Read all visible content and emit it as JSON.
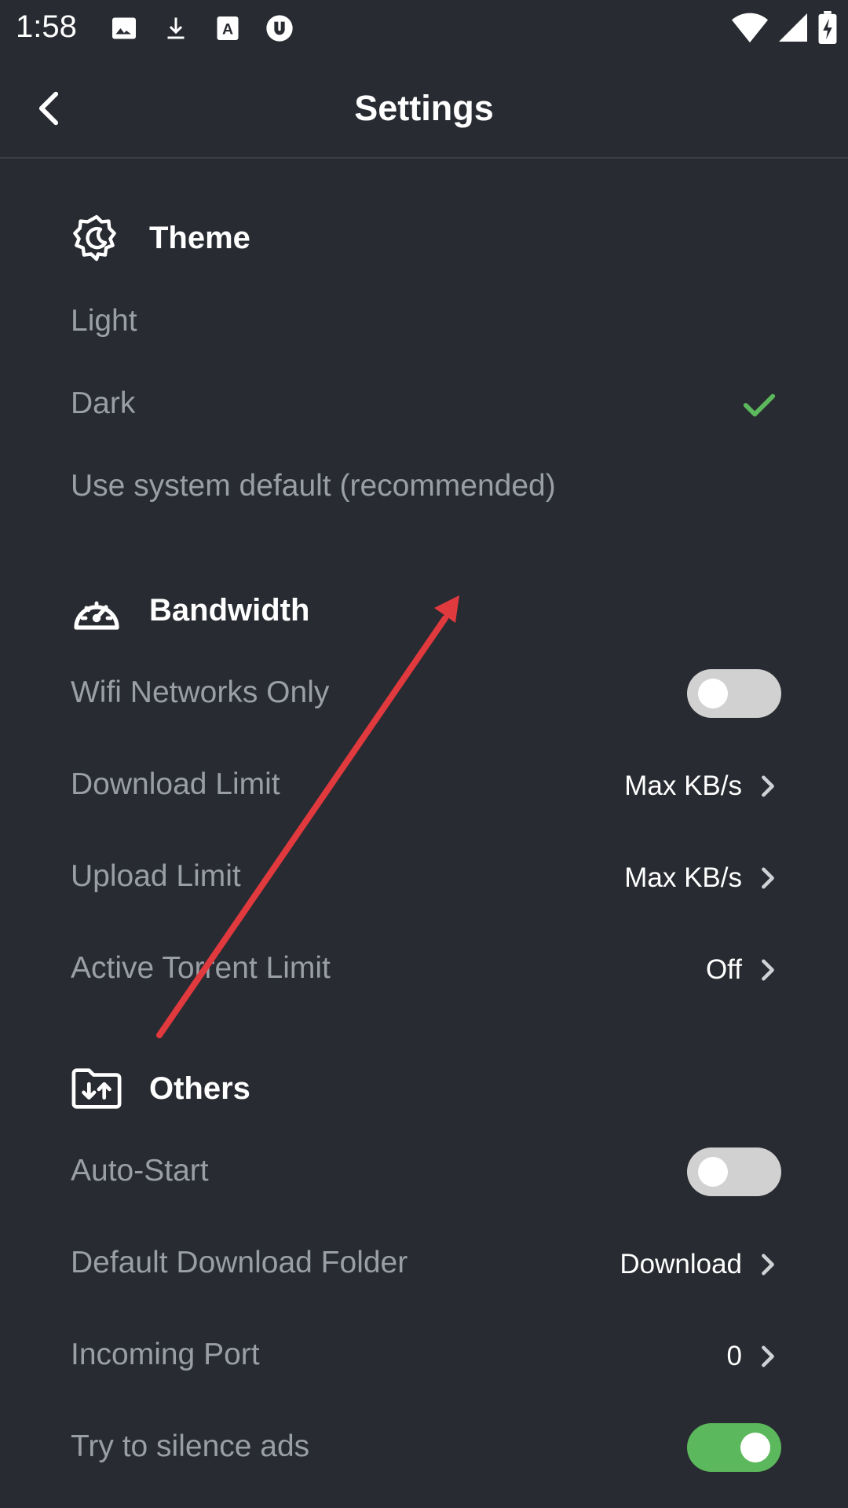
{
  "status_bar": {
    "time": "1:58",
    "left_icons": [
      "image-icon",
      "download-icon",
      "text-a-icon",
      "utorrent-icon"
    ],
    "right_icons": [
      "wifi-icon",
      "signal-icon",
      "battery-charging-icon"
    ]
  },
  "app_bar": {
    "title": "Settings",
    "back_icon": "chevron-left-icon"
  },
  "theme": {
    "title": "Theme",
    "icon": "theme-gear-icon",
    "options": [
      {
        "label": "Light",
        "selected": false
      },
      {
        "label": "Dark",
        "selected": true
      },
      {
        "label": "Use system default (recommended)",
        "selected": false
      }
    ]
  },
  "bandwidth": {
    "title": "Bandwidth",
    "icon": "speedometer-icon",
    "items": [
      {
        "label": "Wifi Networks Only",
        "toggle": false
      },
      {
        "label": "Download Limit",
        "value": "Max KB/s"
      },
      {
        "label": "Upload Limit",
        "value": "Max KB/s"
      },
      {
        "label": "Active Torrent Limit",
        "value": "Off"
      }
    ]
  },
  "others": {
    "title": "Others",
    "icon": "folder-transfer-icon",
    "items": [
      {
        "label": "Auto-Start",
        "toggle": false
      },
      {
        "label": "Default Download Folder",
        "value": "Download"
      },
      {
        "label": "Incoming Port",
        "value": "0"
      },
      {
        "label": "Try to silence ads",
        "toggle": true
      }
    ]
  },
  "colors": {
    "background": "#282b31",
    "label": "#9a9ea6",
    "accent_green": "#5cb85c",
    "annotation_arrow": "#e0393e"
  }
}
